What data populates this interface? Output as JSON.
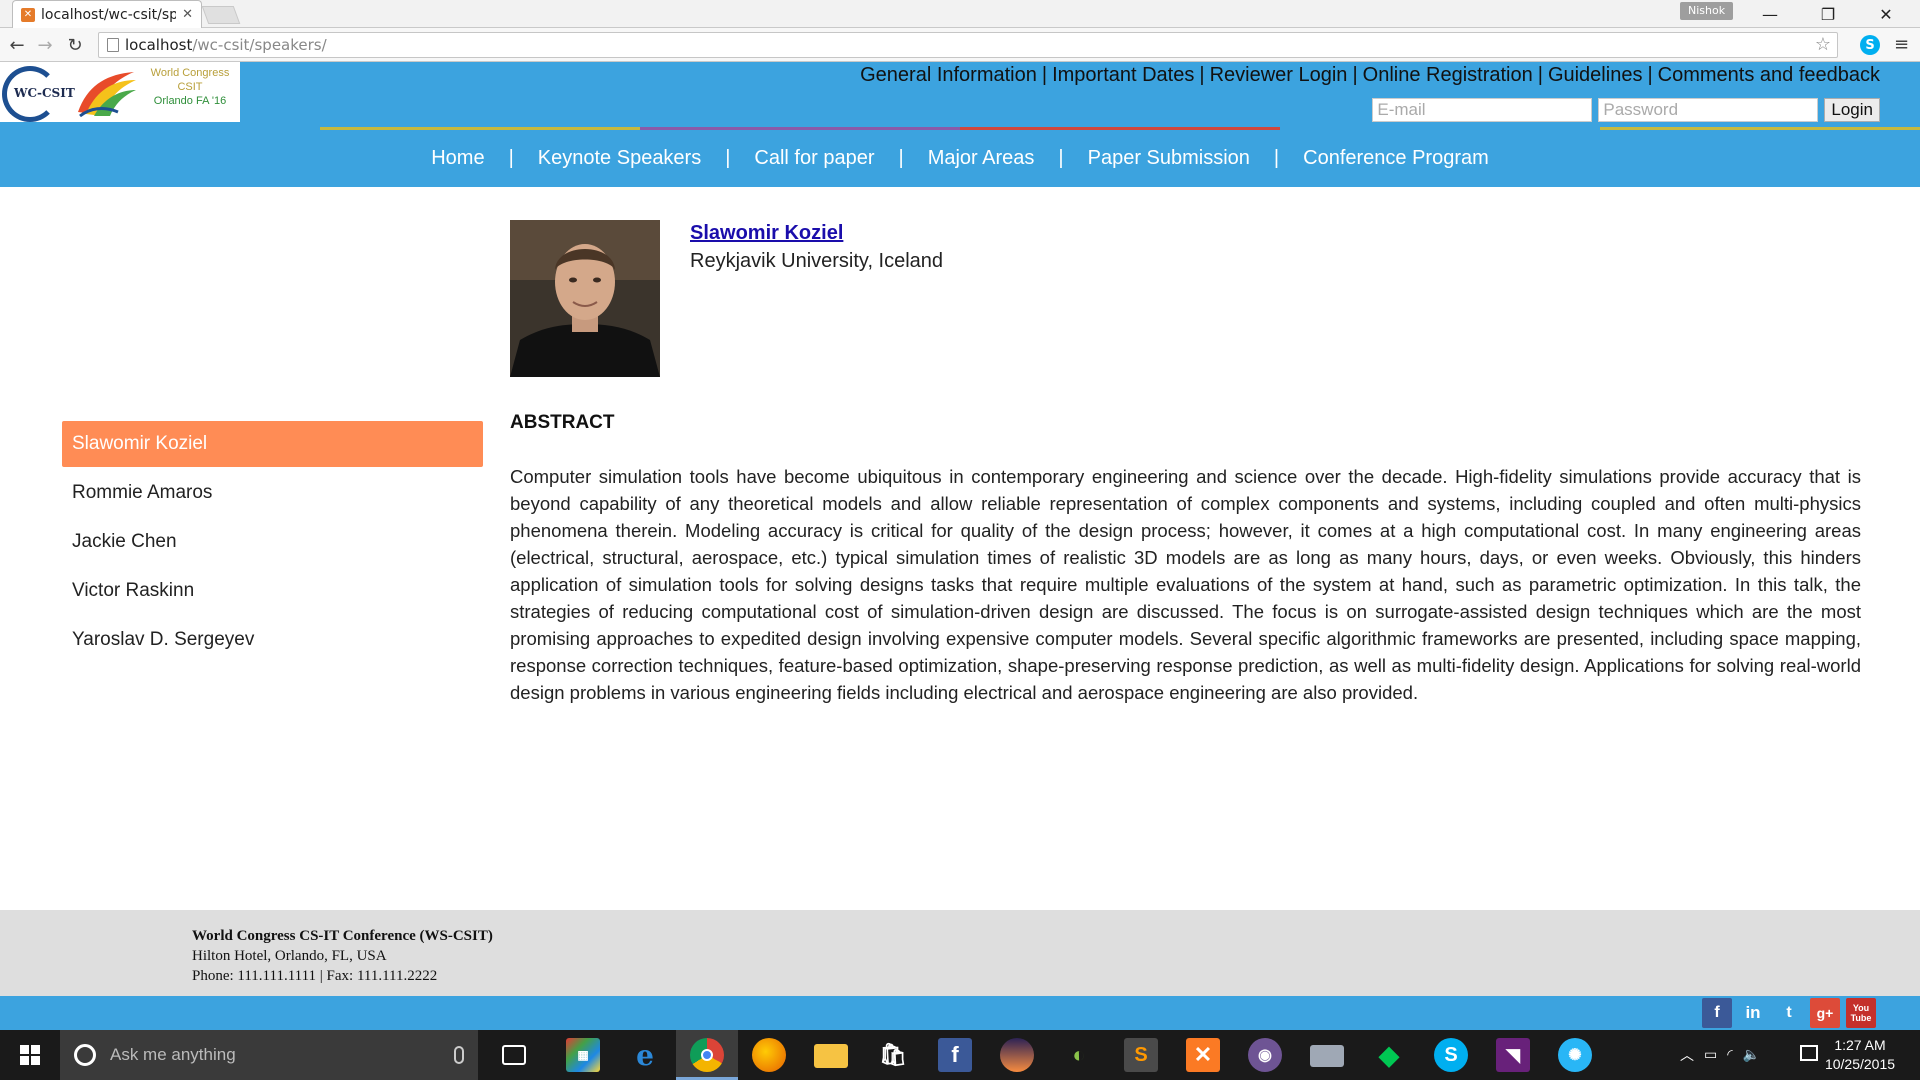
{
  "browser": {
    "tab_title": "localhost/wc-csit/spe",
    "profile_name": "Nishok",
    "url_host": "localhost",
    "url_path": "/wc-csit/speakers/"
  },
  "logo": {
    "abbr": "WC-CSIT",
    "line1": "World Congress",
    "line2": "CSIT",
    "line3": "Orlando FA '16"
  },
  "top_links": [
    "General Information",
    "Important Dates",
    "Reviewer Login",
    "Online Registration",
    "Guidelines",
    "Comments and feedback"
  ],
  "login": {
    "email_placeholder": "E-mail",
    "password_placeholder": "Password",
    "button_label": "Login"
  },
  "colors": {
    "header_blue": "#3ca3df",
    "active_orange": "#ff8c55",
    "stripe": [
      "#3ca3df",
      "#c6b93f",
      "#8a5aa8",
      "#d0473c",
      "#3ca3df",
      "#c6b93f"
    ]
  },
  "main_nav": [
    "Home",
    "Keynote Speakers",
    "Call for paper",
    "Major Areas",
    "Paper Submission",
    "Conference Program"
  ],
  "sidebar": {
    "speakers": [
      "Slawomir Koziel",
      "Rommie Amaros",
      "Jackie Chen",
      "Victor Raskinn",
      "Yaroslav D. Sergeyev"
    ],
    "active_index": 0
  },
  "speaker": {
    "name": "Slawomir Koziel",
    "affiliation": "Reykjavik University, Iceland",
    "abstract_heading": "ABSTRACT",
    "abstract": "Computer simulation tools have become ubiquitous in contemporary engineering and science over the decade. High-fidelity simulations provide accuracy that is beyond capability of any theoretical models and allow reliable representation of complex components and systems, including coupled and often multi-physics phenomena therein. Modeling accuracy is critical for quality of the design process; however, it comes at a high computational cost. In many engineering areas (electrical, structural, aerospace, etc.) typical simulation times of realistic 3D models are as long as many hours, days, or even weeks. Obviously, this hinders application of simulation tools for solving designs tasks that require multiple evaluations of the system at hand, such as parametric optimization. In this talk, the strategies of reducing computational cost of simulation-driven design are discussed. The focus is on surrogate-assisted design techniques which are the most promising approaches to expedited design involving expensive computer models. Several specific algorithmic frameworks are presented, including space mapping, response correction techniques, feature-based optimization, shape-preserving response prediction, as well as multi-fidelity design. Applications for solving real-world design problems in various engineering fields including electrical and aerospace engineering are also provided."
  },
  "footer": {
    "org": "World Congress CS-IT Conference (WS-CSIT)",
    "address": "Hilton Hotel, Orlando, FL, USA",
    "phone": "Phone: 111.111.1111 | Fax: 111.111.2222"
  },
  "social": [
    {
      "name": "facebook-icon",
      "glyph": "f",
      "color": "#3b5998"
    },
    {
      "name": "linkedin-icon",
      "glyph": "in",
      "color": "#3ca3df"
    },
    {
      "name": "twitter-icon",
      "glyph": "t",
      "color": "#3ca3df"
    },
    {
      "name": "googleplus-icon",
      "glyph": "g+",
      "color": "#dd4b39"
    },
    {
      "name": "youtube-icon",
      "glyph": "You Tube",
      "color": "#c4302b"
    }
  ],
  "taskbar": {
    "search_placeholder": "Ask me anything",
    "time": "1:27 AM",
    "date": "10/25/2015"
  }
}
